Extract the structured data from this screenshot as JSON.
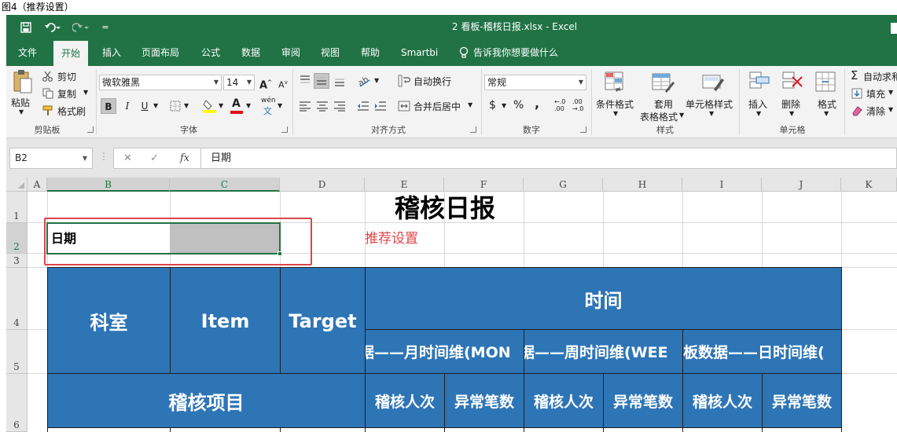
{
  "caption": "图4（推荐设置）",
  "window": {
    "title": "2 看板-稽核日报.xlsx  -  Excel",
    "qat_dropdown": "="
  },
  "tabs": [
    "文件",
    "开始",
    "插入",
    "页面布局",
    "公式",
    "数据",
    "审阅",
    "视图",
    "帮助",
    "Smartbi"
  ],
  "active_tab": "开始",
  "tellme": "告诉我你想要做什么",
  "ribbon": {
    "clipboard": {
      "paste": "粘贴",
      "cut": "剪切",
      "copy": "复制",
      "format_painter": "格式刷",
      "label": "剪贴板"
    },
    "font": {
      "name": "微软雅黑",
      "size": "14",
      "bold": "B",
      "italic": "I",
      "underline": "U",
      "grow": "A",
      "shrink": "A",
      "wen": "wén",
      "label": "字体"
    },
    "alignment": {
      "wrap": "自动换行",
      "merge": "合并后居中",
      "label": "对齐方式"
    },
    "number": {
      "format": "常规",
      "currency": "$",
      "percent": "%",
      "comma": ",",
      "inc": ".0",
      "dec": ".00",
      "label": "数字"
    },
    "styles": {
      "conditional": "条件格式",
      "table": "套用",
      "table2": "表格格式",
      "cell": "单元格样式",
      "label": "样式"
    },
    "cells": {
      "insert": "插入",
      "delete": "删除",
      "format": "格式",
      "label": "单元格"
    },
    "editing": {
      "autosum": "自动求和",
      "fill": "填充",
      "clear": "清除"
    }
  },
  "formula_bar": {
    "name_box": "B2",
    "cancel": "✕",
    "enter": "✓",
    "fx": "fx",
    "value": "日期"
  },
  "columns": [
    "A",
    "B",
    "C",
    "D",
    "E",
    "F",
    "G",
    "H",
    "I",
    "J",
    "K"
  ],
  "rows": [
    "1",
    "2",
    "3",
    "4",
    "5",
    "6"
  ],
  "sheet": {
    "title": "稽核日报",
    "b2": "日期",
    "note": "推荐设置",
    "h_dept": "科室",
    "h_item": "Item",
    "h_target": "Target",
    "h_time": "时间",
    "h_month": "据——月时间维(MON",
    "h_week": "据——周时间维(WEE",
    "h_day": "板数据——日时间维(",
    "h_audit": "稽核项目",
    "h_persons": "稽核人次",
    "h_errors": "异常笔数"
  }
}
